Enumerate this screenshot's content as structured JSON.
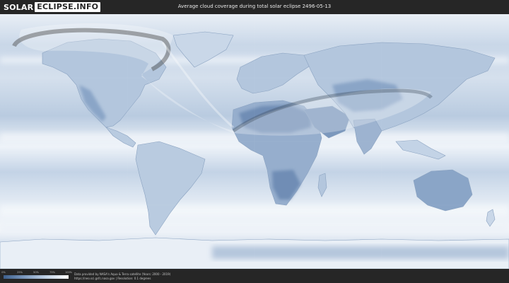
{
  "logo": {
    "part1": "SOLAR",
    "part2": "ECLIPSE.INFO"
  },
  "map": {
    "title": "Average cloud coverage during total solar eclipse 2496-05-13"
  },
  "legend": {
    "ticks": [
      "0%",
      "25%",
      "50%",
      "75%",
      "100%"
    ],
    "colors": [
      "#3d5f8c",
      "#7f9bbf",
      "#c3d3e6",
      "#ffffff"
    ]
  },
  "footer": {
    "credit_line1": "Data provided by NASA's Aqua & Terra satellite (Years: 2000 - 2019)",
    "credit_line2": "https://neo.sci.gsfc.nasa.gov | Resolution: 0.1 degrees"
  }
}
